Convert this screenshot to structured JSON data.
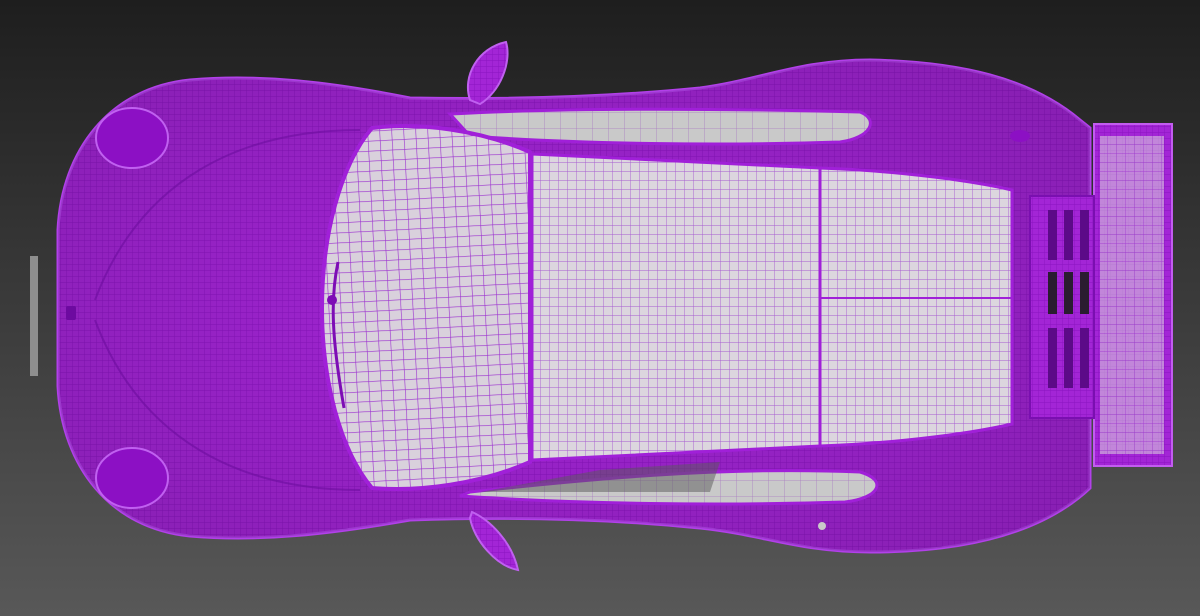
{
  "viewport": {
    "background_top": "#1e1e1e",
    "background_bottom": "#585858"
  },
  "model": {
    "wire_color": "#a020d8",
    "wire_light": "#b646e8",
    "panel_color": "#cfcfcf",
    "panel_shadow": "#9a9a9a",
    "dark_gap": "#2a1c30"
  }
}
